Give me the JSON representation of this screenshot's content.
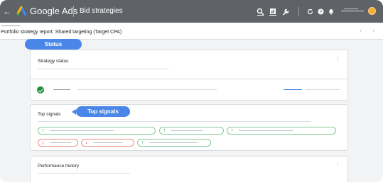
{
  "app": {
    "brand": "Google Ads",
    "page": "Bid strategies"
  },
  "header": {
    "report_title": "Portfolio strategy report: Shared targeting (Target CPA)"
  },
  "icons": {
    "back": "arrow-back-icon",
    "search": "search-icon",
    "reports": "reports-icon",
    "tools": "wrench-icon",
    "refresh": "refresh-icon",
    "help": "help-icon",
    "notifications": "bell-icon",
    "prev": "chevron-left-icon",
    "next": "chevron-right-icon"
  },
  "cards": {
    "status": {
      "title": "Strategy status"
    },
    "signals": {
      "title": "Top signals"
    },
    "history": {
      "title": "Performance history"
    }
  },
  "callouts": {
    "status": "Status",
    "signals": "Top signals"
  },
  "signals": {
    "row1": [
      "up",
      "up",
      "up"
    ],
    "row2": [
      "down",
      "down",
      "up"
    ]
  },
  "colors": {
    "topbar": "#5f6368",
    "callout": "#4a86e8",
    "positive": "#1e8e3e",
    "negative": "#d93025",
    "avatar": "#f6ae2d"
  }
}
